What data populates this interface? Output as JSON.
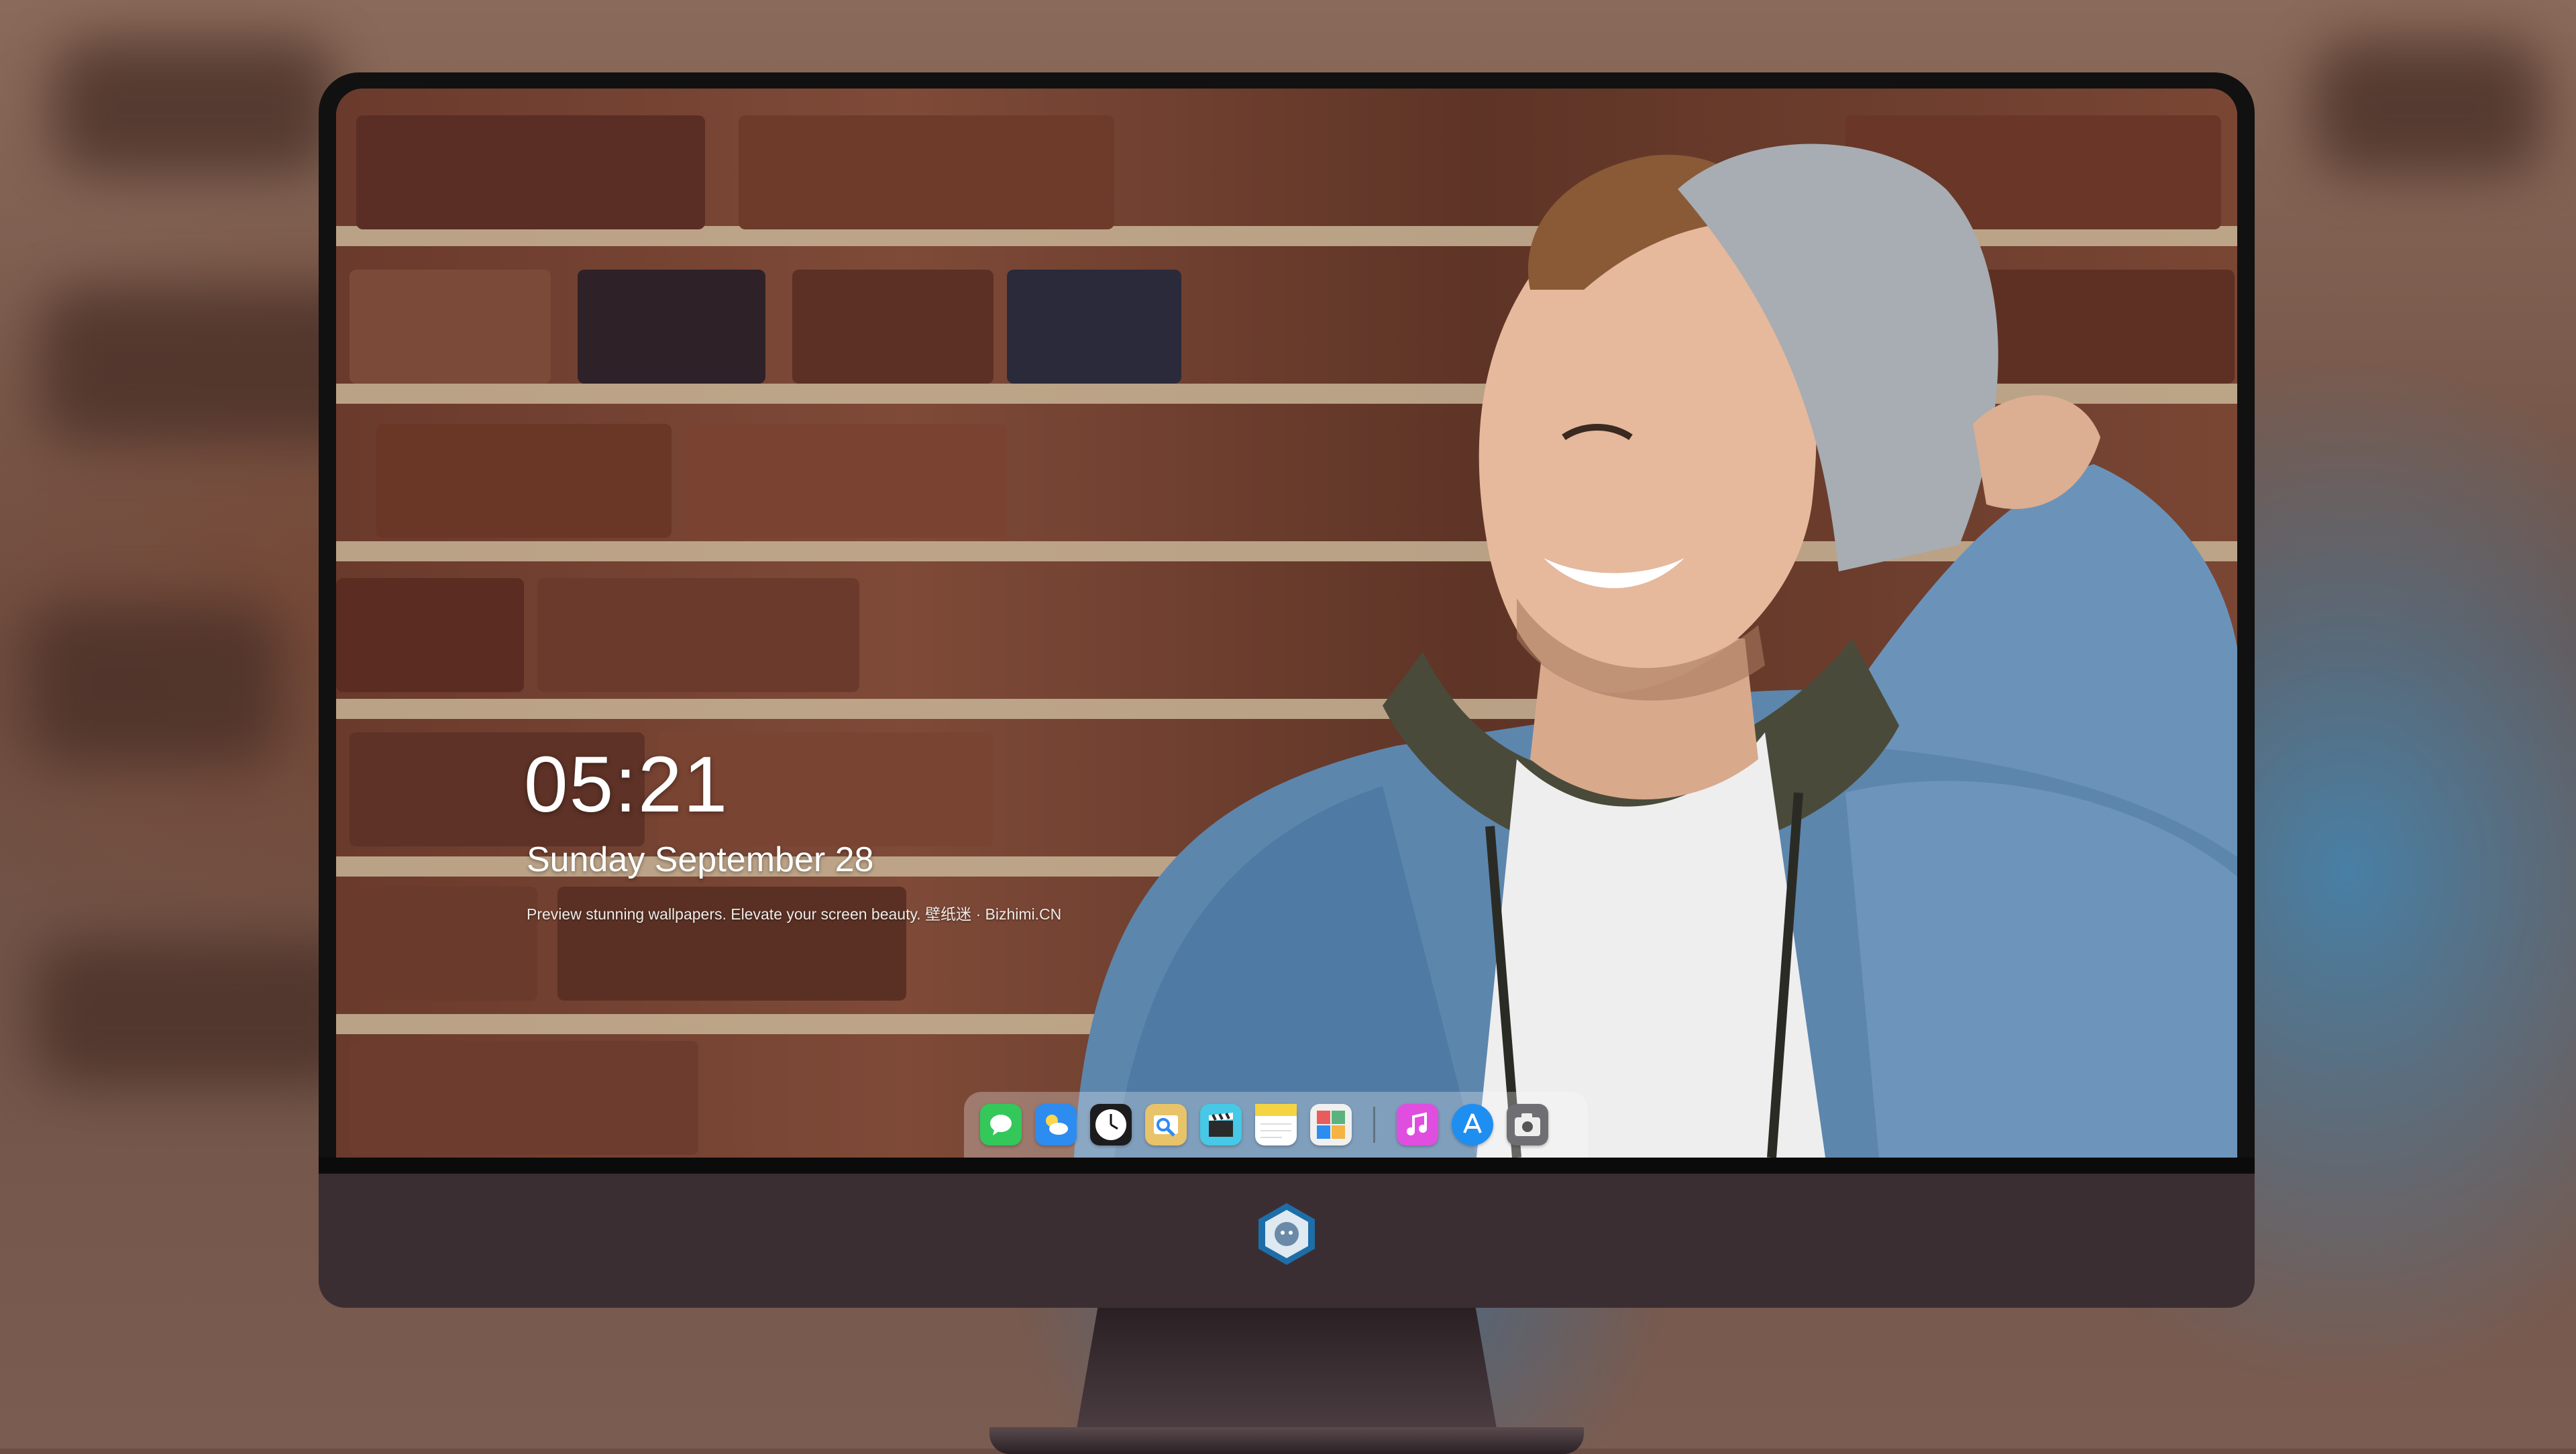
{
  "lockscreen": {
    "time": "05:21",
    "date": "Sunday September  28",
    "tagline": "Preview stunning wallpapers. Elevate your screen beauty. 壁纸迷 · Bizhimi.CN"
  },
  "dock": {
    "apps": [
      {
        "name": "messages-icon",
        "color": "#34c759"
      },
      {
        "name": "weather-icon",
        "color": "#2d8cf0"
      },
      {
        "name": "clock-icon",
        "color": "#1c1c1e"
      },
      {
        "name": "preview-icon",
        "color": "#e8c36a"
      },
      {
        "name": "clips-icon",
        "color": "#46c8e6"
      },
      {
        "name": "notes-icon",
        "color": "#f5d443"
      },
      {
        "name": "photo-booth-icon",
        "color": "#5ab37d"
      },
      {
        "name": "music-icon",
        "color": "#e04ee0"
      },
      {
        "name": "app-store-icon",
        "color": "#1f8ef1"
      },
      {
        "name": "screenshot-icon",
        "color": "#6e6e73"
      }
    ]
  },
  "colors": {
    "chin": "#3b2e33",
    "bezel": "#111111"
  }
}
